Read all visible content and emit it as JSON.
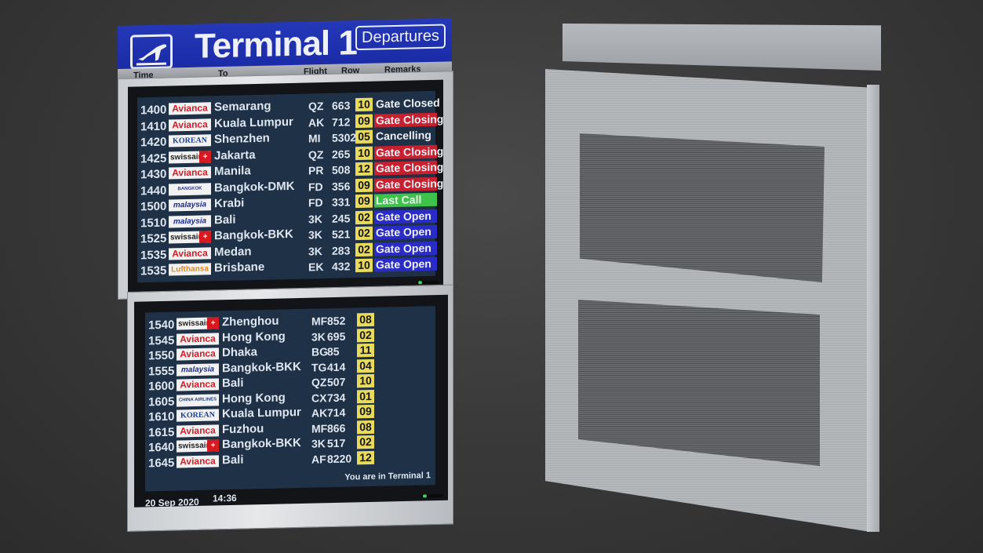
{
  "header": {
    "icon": "departing-plane-icon",
    "title": "Terminal 1",
    "badge": "Departures"
  },
  "columns": [
    "Time",
    "To",
    "Flight",
    "Row",
    "Remarks"
  ],
  "colors": {
    "header_blue": "#1f30b0",
    "gate_yellow": "#e8da5a",
    "closing_red": "#c8202e",
    "last_call_green": "#3fc24a",
    "open_blue": "#2a2cc8",
    "screen_bg": "#1f3146"
  },
  "upper_board": [
    {
      "time": "1400",
      "airline": "Avianca",
      "logo": "avianca",
      "dest": "Semarang",
      "air": "QZ",
      "no": "663",
      "row": "10",
      "remark": "Gate Closed",
      "status": "closed"
    },
    {
      "time": "1410",
      "airline": "Avianca",
      "logo": "avianca",
      "dest": "Kuala Lumpur",
      "air": "AK",
      "no": "712",
      "row": "09",
      "remark": "Gate Closing",
      "status": "closing"
    },
    {
      "time": "1420",
      "airline": "KOREAN AIR",
      "logo": "korean",
      "dest": "Shenzhen",
      "air": "MI",
      "no": "5302",
      "row": "05",
      "remark": "Cancelling",
      "status": "closed"
    },
    {
      "time": "1425",
      "airline": "swissair",
      "logo": "swissair",
      "dest": "Jakarta",
      "air": "QZ",
      "no": "265",
      "row": "10",
      "remark": "Gate Closing",
      "status": "closing"
    },
    {
      "time": "1430",
      "airline": "Avianca",
      "logo": "avianca",
      "dest": "Manila",
      "air": "PR",
      "no": "508",
      "row": "12",
      "remark": "Gate Closing",
      "status": "closing"
    },
    {
      "time": "1440",
      "airline": "BANGKOK AIRWAYS",
      "logo": "bangkokair",
      "dest": "Bangkok-DMK",
      "air": "FD",
      "no": "356",
      "row": "09",
      "remark": "Gate Closing",
      "status": "closing"
    },
    {
      "time": "1500",
      "airline": "malaysia",
      "logo": "malaysia",
      "dest": "Krabi",
      "air": "FD",
      "no": "331",
      "row": "09",
      "remark": "Last Call",
      "status": "lastcall"
    },
    {
      "time": "1510",
      "airline": "malaysia",
      "logo": "malaysia",
      "dest": "Bali",
      "air": "3K",
      "no": "245",
      "row": "02",
      "remark": "Gate Open",
      "status": "open"
    },
    {
      "time": "1525",
      "airline": "swissair",
      "logo": "swissair",
      "dest": "Bangkok-BKK",
      "air": "3K",
      "no": "521",
      "row": "02",
      "remark": "Gate Open",
      "status": "open"
    },
    {
      "time": "1535",
      "airline": "Avianca",
      "logo": "avianca",
      "dest": "Medan",
      "air": "3K",
      "no": "283",
      "row": "02",
      "remark": "Gate Open",
      "status": "open"
    },
    {
      "time": "1535",
      "airline": "Lufthansa",
      "logo": "lufthansa",
      "dest": "Brisbane",
      "air": "EK",
      "no": "432",
      "row": "10",
      "remark": "Gate Open",
      "status": "open"
    }
  ],
  "lower_board": [
    {
      "time": "1540",
      "airline": "swissair",
      "logo": "swissair",
      "dest": "Zhenghou",
      "air": "MF",
      "no": "852",
      "row": "08"
    },
    {
      "time": "1545",
      "airline": "Avianca",
      "logo": "avianca",
      "dest": "Hong Kong",
      "air": "3K",
      "no": "695",
      "row": "02"
    },
    {
      "time": "1550",
      "airline": "Avianca",
      "logo": "avianca",
      "dest": "Dhaka",
      "air": "BG",
      "no": "85",
      "row": "11"
    },
    {
      "time": "1555",
      "airline": "malaysia",
      "logo": "malaysia",
      "dest": "Bangkok-BKK",
      "air": "TG",
      "no": "414",
      "row": "04"
    },
    {
      "time": "1600",
      "airline": "Avianca",
      "logo": "avianca",
      "dest": "Bali",
      "air": "QZ",
      "no": "507",
      "row": "10"
    },
    {
      "time": "1605",
      "airline": "CHINA AIRLINES",
      "logo": "china",
      "dest": "Hong Kong",
      "air": "CX",
      "no": "734",
      "row": "01"
    },
    {
      "time": "1610",
      "airline": "KOREAN AIR",
      "logo": "korean",
      "dest": "Kuala Lumpur",
      "air": "AK",
      "no": "714",
      "row": "09"
    },
    {
      "time": "1615",
      "airline": "Avianca",
      "logo": "avianca",
      "dest": "Fuzhou",
      "air": "MF",
      "no": "866",
      "row": "08"
    },
    {
      "time": "1640",
      "airline": "swissair",
      "logo": "swissair",
      "dest": "Bangkok-BKK",
      "air": "3K",
      "no": "517",
      "row": "02"
    },
    {
      "time": "1645",
      "airline": "Avianca",
      "logo": "avianca",
      "dest": "Bali",
      "air": "AF",
      "no": "8220",
      "row": "12"
    }
  ],
  "footer": {
    "date": "20 Sep 2020",
    "time": "14:36",
    "location_note": "You are in Terminal 1"
  },
  "back_panel": {
    "label": "Rear view of display stand (brushed steel with two speaker grilles)"
  }
}
